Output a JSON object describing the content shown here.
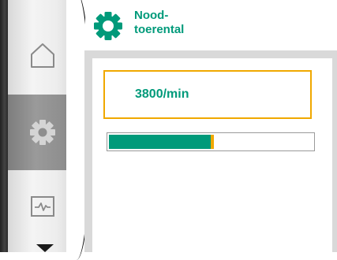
{
  "header": {
    "title_line1": "Nood-",
    "title_line2": "toerental",
    "icon": "gear-icon"
  },
  "nav": {
    "items": [
      {
        "icon": "home-icon",
        "active": false
      },
      {
        "icon": "gear-icon",
        "active": true
      },
      {
        "icon": "pulse-icon",
        "active": false
      }
    ],
    "scroll_indicator": "chevron-down-icon"
  },
  "main": {
    "value": "3800/min",
    "progress_fraction": 0.5
  },
  "colors": {
    "accent": "#009a7a",
    "highlight": "#f0a800",
    "frame": "#d9d9d9",
    "active_nav": "#8e8e8e"
  }
}
